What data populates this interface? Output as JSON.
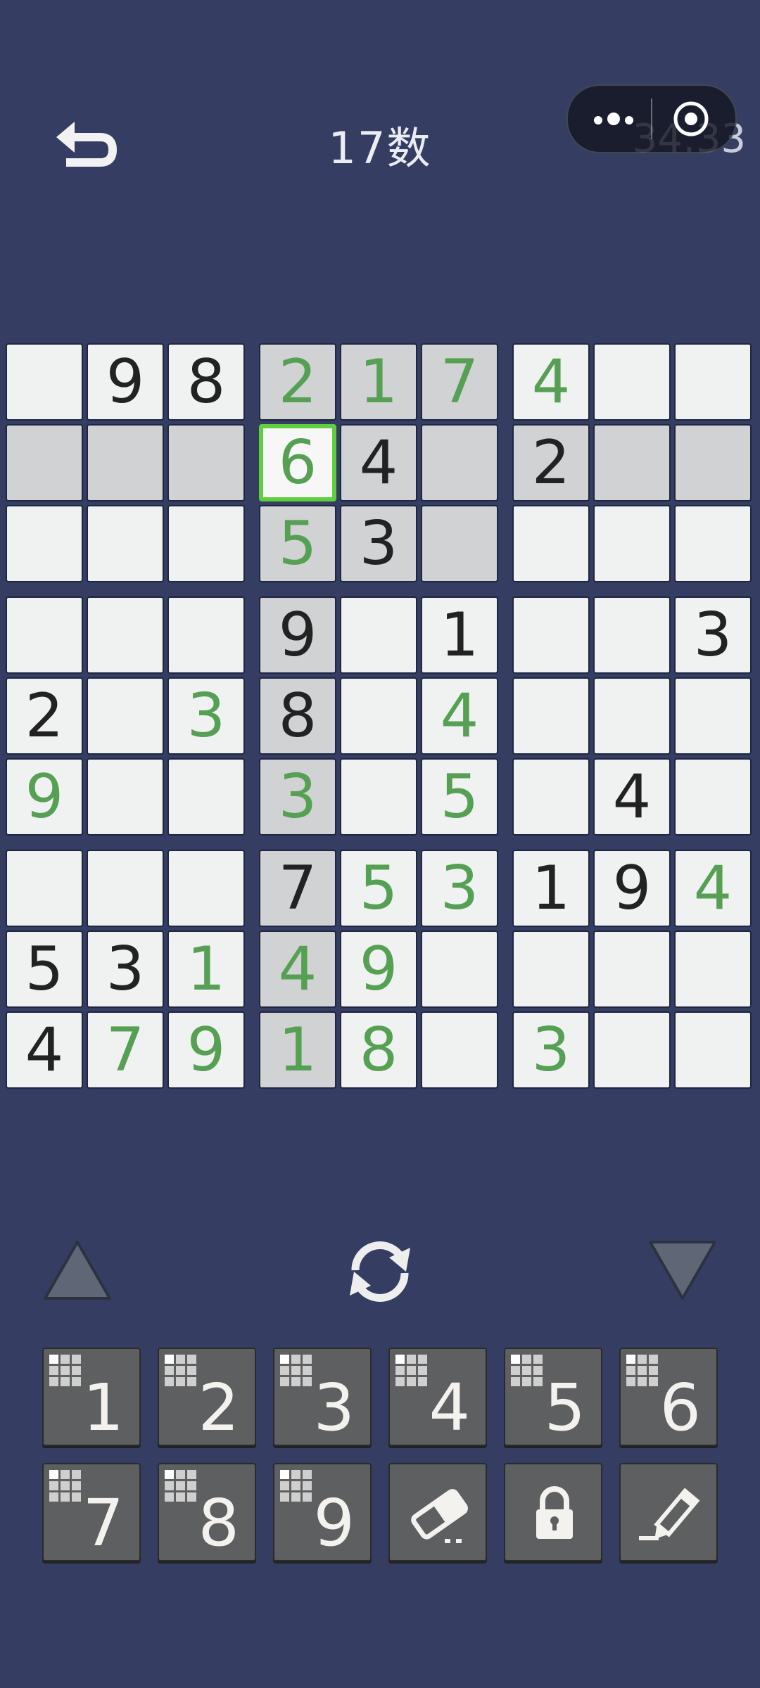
{
  "header": {
    "title": "17数",
    "timer": "34:33"
  },
  "icons": {
    "back": "undo-arrow-icon",
    "capsule_more": "more-dots-icon",
    "capsule_close": "target-circle-icon",
    "move_up": "triangle-up-icon",
    "move_down": "triangle-down-icon",
    "refresh": "refresh-cycle-icon",
    "erase": "eraser-icon",
    "lock": "padlock-icon",
    "pencil": "pencil-icon"
  },
  "colors": {
    "background": "#353e62",
    "cell": "#f0f1f1",
    "cell_highlight": "#d1d2d3",
    "selected_border": "#5fcf3e",
    "given_digit": "#222222",
    "entered_digit": "#56a054",
    "key": "#5e5f60"
  },
  "board": {
    "selected": [
      1,
      3
    ],
    "highlighted": [
      [
        0,
        3
      ],
      [
        0,
        4
      ],
      [
        0,
        5
      ],
      [
        1,
        0
      ],
      [
        1,
        1
      ],
      [
        1,
        2
      ],
      [
        1,
        4
      ],
      [
        1,
        5
      ],
      [
        1,
        6
      ],
      [
        1,
        7
      ],
      [
        1,
        8
      ],
      [
        2,
        3
      ],
      [
        2,
        4
      ],
      [
        2,
        5
      ],
      [
        3,
        3
      ],
      [
        4,
        3
      ],
      [
        5,
        3
      ],
      [
        6,
        3
      ],
      [
        7,
        3
      ],
      [
        8,
        3
      ]
    ],
    "rows": [
      [
        "",
        "9",
        "8",
        "2",
        "1",
        "7",
        "4",
        "",
        ""
      ],
      [
        "",
        "",
        "",
        "6",
        "4",
        "",
        "2",
        "",
        ""
      ],
      [
        "",
        "",
        "",
        "5",
        "3",
        "",
        "",
        "",
        ""
      ],
      [
        "",
        "",
        "",
        "9",
        "",
        "1",
        "",
        "",
        "3"
      ],
      [
        "2",
        "",
        "3",
        "8",
        "",
        "4",
        "",
        "",
        ""
      ],
      [
        "9",
        "",
        "",
        "3",
        "",
        "5",
        "",
        "4",
        ""
      ],
      [
        "",
        "",
        "",
        "7",
        "5",
        "3",
        "1",
        "9",
        "4"
      ],
      [
        "5",
        "3",
        "1",
        "4",
        "9",
        "",
        "",
        "",
        ""
      ],
      [
        "4",
        "7",
        "9",
        "1",
        "8",
        "",
        "3",
        "",
        ""
      ]
    ],
    "kinds": [
      [
        "",
        "g",
        "g",
        "u",
        "u",
        "u",
        "u",
        "",
        ""
      ],
      [
        "",
        "",
        "",
        "u",
        "g",
        "",
        "g",
        "",
        ""
      ],
      [
        "",
        "",
        "",
        "u",
        "g",
        "",
        "",
        "",
        ""
      ],
      [
        "",
        "",
        "",
        "g",
        "",
        "g",
        "",
        "",
        "g"
      ],
      [
        "g",
        "",
        "u",
        "g",
        "",
        "u",
        "",
        "",
        ""
      ],
      [
        "u",
        "",
        "",
        "u",
        "",
        "u",
        "",
        "g",
        ""
      ],
      [
        "",
        "",
        "",
        "g",
        "u",
        "u",
        "g",
        "g",
        "u"
      ],
      [
        "g",
        "g",
        "u",
        "u",
        "u",
        "",
        "",
        "",
        ""
      ],
      [
        "g",
        "u",
        "u",
        "u",
        "u",
        "",
        "u",
        "",
        ""
      ]
    ]
  },
  "keypad": {
    "digits": [
      "1",
      "2",
      "3",
      "4",
      "5",
      "6",
      "7",
      "8",
      "9"
    ],
    "grid_icon": "digit-count-grid-icon",
    "tools": [
      "eraser-icon",
      "padlock-icon",
      "pencil-icon"
    ]
  }
}
